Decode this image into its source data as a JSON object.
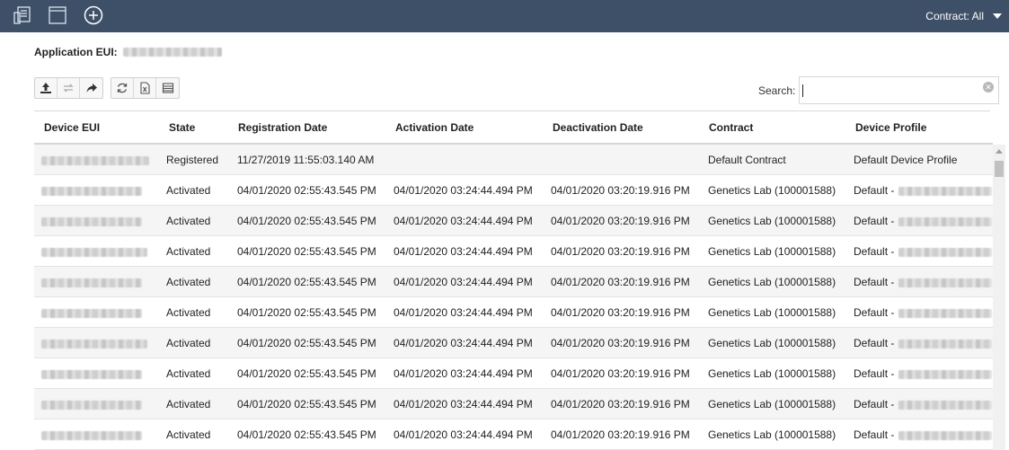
{
  "topbar": {
    "icons": [
      "device-list-icon",
      "window-icon",
      "add-circle-icon"
    ],
    "contract_label": "Contract: All"
  },
  "app": {
    "eui_label": "Application EUI:"
  },
  "toolbar": {
    "group1": [
      "upload-icon",
      "repeat-icon",
      "share-icon"
    ],
    "group2": [
      "refresh-icon",
      "excel-export-icon",
      "table-view-icon"
    ]
  },
  "search": {
    "label": "Search:",
    "value": "",
    "placeholder": ""
  },
  "table": {
    "columns": [
      "Device EUI",
      "State",
      "Registration Date",
      "Activation Date",
      "Deactivation Date",
      "Contract",
      "Device Profile"
    ],
    "rows": [
      {
        "state": "Registered",
        "registration": "11/27/2019 11:55:03.140 AM",
        "activation": "",
        "deactivation": "",
        "contract": "Default Contract",
        "profile": "Default Device Profile"
      },
      {
        "state": "Activated",
        "registration": "04/01/2020 02:55:43.545 PM",
        "activation": "04/01/2020 03:24:44.494 PM",
        "deactivation": "04/01/2020 03:20:19.916 PM",
        "contract": "Genetics Lab (100001588)",
        "profile": "Default -"
      },
      {
        "state": "Activated",
        "registration": "04/01/2020 02:55:43.545 PM",
        "activation": "04/01/2020 03:24:44.494 PM",
        "deactivation": "04/01/2020 03:20:19.916 PM",
        "contract": "Genetics Lab (100001588)",
        "profile": "Default -"
      },
      {
        "state": "Activated",
        "registration": "04/01/2020 02:55:43.545 PM",
        "activation": "04/01/2020 03:24:44.494 PM",
        "deactivation": "04/01/2020 03:20:19.916 PM",
        "contract": "Genetics Lab (100001588)",
        "profile": "Default -"
      },
      {
        "state": "Activated",
        "registration": "04/01/2020 02:55:43.545 PM",
        "activation": "04/01/2020 03:24:44.494 PM",
        "deactivation": "04/01/2020 03:20:19.916 PM",
        "contract": "Genetics Lab (100001588)",
        "profile": "Default -"
      },
      {
        "state": "Activated",
        "registration": "04/01/2020 02:55:43.545 PM",
        "activation": "04/01/2020 03:24:44.494 PM",
        "deactivation": "04/01/2020 03:20:19.916 PM",
        "contract": "Genetics Lab (100001588)",
        "profile": "Default -"
      },
      {
        "state": "Activated",
        "registration": "04/01/2020 02:55:43.545 PM",
        "activation": "04/01/2020 03:24:44.494 PM",
        "deactivation": "04/01/2020 03:20:19.916 PM",
        "contract": "Genetics Lab (100001588)",
        "profile": "Default -"
      },
      {
        "state": "Activated",
        "registration": "04/01/2020 02:55:43.545 PM",
        "activation": "04/01/2020 03:24:44.494 PM",
        "deactivation": "04/01/2020 03:20:19.916 PM",
        "contract": "Genetics Lab (100001588)",
        "profile": "Default -"
      },
      {
        "state": "Activated",
        "registration": "04/01/2020 02:55:43.545 PM",
        "activation": "04/01/2020 03:24:44.494 PM",
        "deactivation": "04/01/2020 03:20:19.916 PM",
        "contract": "Genetics Lab (100001588)",
        "profile": "Default -"
      },
      {
        "state": "Activated",
        "registration": "04/01/2020 02:55:43.545 PM",
        "activation": "04/01/2020 03:24:44.494 PM",
        "deactivation": "04/01/2020 03:20:19.916 PM",
        "contract": "Genetics Lab (100001588)",
        "profile": "Default -"
      }
    ]
  },
  "colors": {
    "topbar": "#3d5068",
    "row_stripe": "#f5f5f5"
  }
}
